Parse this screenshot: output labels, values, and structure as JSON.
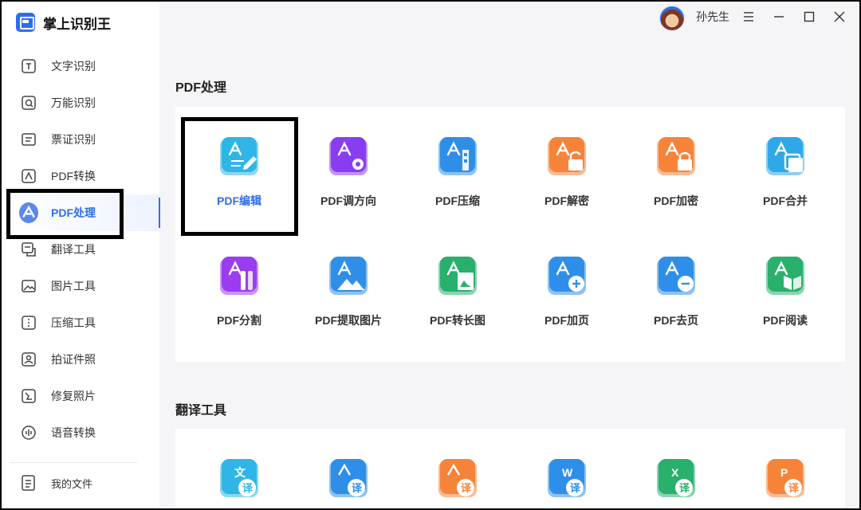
{
  "app": {
    "name": "掌上识别王"
  },
  "user": {
    "name": "孙先生"
  },
  "sidebar": {
    "items": [
      {
        "label": "文字识别",
        "icon": "text-scan-icon"
      },
      {
        "label": "万能识别",
        "icon": "search-doc-icon"
      },
      {
        "label": "票证识别",
        "icon": "ticket-icon"
      },
      {
        "label": "PDF转换",
        "icon": "pdf-convert-icon"
      },
      {
        "label": "PDF处理",
        "icon": "pdf-process-icon",
        "active": true
      },
      {
        "label": "翻译工具",
        "icon": "translate-icon"
      },
      {
        "label": "图片工具",
        "icon": "image-icon"
      },
      {
        "label": "压缩工具",
        "icon": "compress-icon"
      },
      {
        "label": "拍证件照",
        "icon": "id-photo-icon"
      },
      {
        "label": "修复照片",
        "icon": "repair-photo-icon"
      },
      {
        "label": "语音转换",
        "icon": "voice-icon"
      }
    ],
    "my_files": "我的文件"
  },
  "sections": {
    "pdf": {
      "title": "PDF处理",
      "tiles": [
        {
          "label": "PDF编辑",
          "icon": "pdf-edit-icon",
          "color": "#2fb6e6",
          "active": true
        },
        {
          "label": "PDF调方向",
          "icon": "pdf-rotate-icon",
          "color": "#8a3df0"
        },
        {
          "label": "PDF压缩",
          "icon": "pdf-compress-icon",
          "color": "#2f8fe8"
        },
        {
          "label": "PDF解密",
          "icon": "pdf-decrypt-icon",
          "color": "#f5843a"
        },
        {
          "label": "PDF加密",
          "icon": "pdf-encrypt-icon",
          "color": "#f5843a"
        },
        {
          "label": "PDF合并",
          "icon": "pdf-merge-icon",
          "color": "#2fa8e8"
        },
        {
          "label": "PDF分割",
          "icon": "pdf-split-icon",
          "color": "#9a3df0"
        },
        {
          "label": "PDF提取图片",
          "icon": "pdf-extract-image-icon",
          "color": "#2f8fe8"
        },
        {
          "label": "PDF转长图",
          "icon": "pdf-long-image-icon",
          "color": "#29b06d"
        },
        {
          "label": "PDF加页",
          "icon": "pdf-add-page-icon",
          "color": "#2f8fe8"
        },
        {
          "label": "PDF去页",
          "icon": "pdf-remove-page-icon",
          "color": "#2f8fe8"
        },
        {
          "label": "PDF阅读",
          "icon": "pdf-read-icon",
          "color": "#29b06d"
        }
      ]
    },
    "translate": {
      "title": "翻译工具",
      "tiles": [
        {
          "glyph": "文",
          "badge": "译",
          "icon": "text-translate-icon",
          "color": "#2fb6e6"
        },
        {
          "glyph": "",
          "badge": "译",
          "icon": "image-translate-icon",
          "color": "#2f8fe8"
        },
        {
          "glyph": "",
          "badge": "译",
          "icon": "pdf-translate-icon",
          "color": "#f5843a"
        },
        {
          "glyph": "W",
          "badge": "译",
          "icon": "word-translate-icon",
          "color": "#2f8fe8"
        },
        {
          "glyph": "X",
          "badge": "译",
          "icon": "excel-translate-icon",
          "color": "#29b06d"
        },
        {
          "glyph": "P",
          "badge": "译",
          "icon": "ppt-translate-icon",
          "color": "#f5843a"
        }
      ]
    }
  }
}
